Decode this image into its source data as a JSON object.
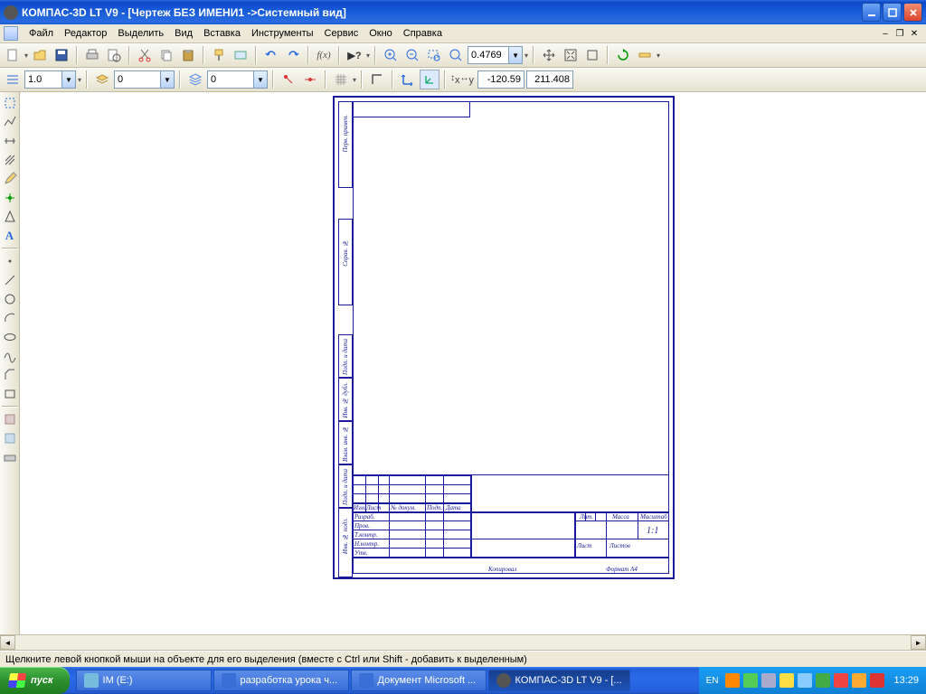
{
  "window": {
    "title": "КОМПАС-3D LT V9 - [Чертеж БЕЗ ИМЕНИ1 ->Системный вид]"
  },
  "menu": {
    "items": [
      "Файл",
      "Редактор",
      "Выделить",
      "Вид",
      "Вставка",
      "Инструменты",
      "Сервис",
      "Окно",
      "Справка"
    ]
  },
  "toolbar1": {
    "scale_value": "0.4769"
  },
  "toolbar2": {
    "linewidth": "1.0",
    "layer": "0",
    "color": "0",
    "coord_x": "-120.59",
    "coord_y": "211.408"
  },
  "titleblock": {
    "cols": [
      "Изм.",
      "Лист",
      "№ докум.",
      "Подп.",
      "Дата"
    ],
    "rows": [
      "Разраб.",
      "Пров.",
      "Т.контр.",
      "Н.контр.",
      "Утв."
    ],
    "hdr": [
      "Лит.",
      "Масса",
      "Масштаб"
    ],
    "one_one": "1:1",
    "sheet_lbl": "Лист",
    "sheets_lbl": "Листов",
    "copy_lbl": "Копировал",
    "format_lbl": "Формат   A4",
    "side_labels": [
      "Инв. № подл.",
      "Подп. и дата",
      "Взам. инв. №",
      "Инв. № дубл.",
      "Подп. и дата",
      "Справ. №",
      "Перв. примен."
    ]
  },
  "status": {
    "text": "Щелкните левой кнопкой мыши на объекте для его выделения (вместе с Ctrl или Shift - добавить к выделенным)"
  },
  "taskbar": {
    "start": "пуск",
    "tasks": [
      {
        "label": "IM (E:)",
        "active": false
      },
      {
        "label": "разработка урока ч...",
        "active": false
      },
      {
        "label": "Документ Microsoft ...",
        "active": false
      },
      {
        "label": "КОМПАС-3D LT V9 - [...",
        "active": true
      }
    ],
    "lang": "EN",
    "clock": "13:29"
  }
}
